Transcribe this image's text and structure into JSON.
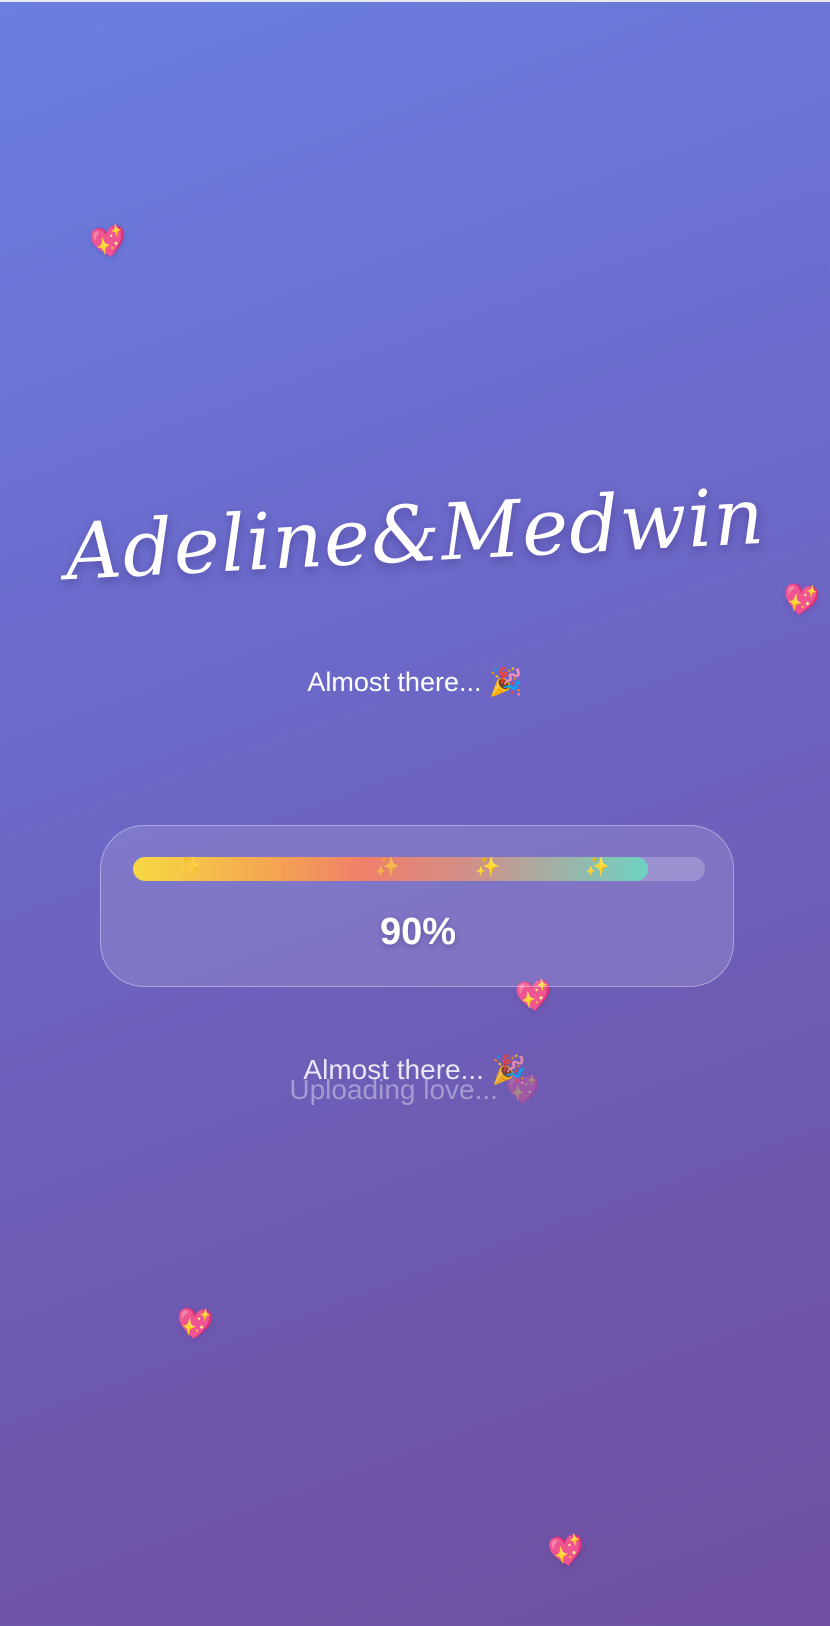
{
  "couple_title": "Adeline&Medwin",
  "subtitle": "Almost there... 🎉",
  "progress": {
    "value_percent": 90,
    "label": "90%"
  },
  "status": {
    "current": "Almost there... 🎉",
    "previous": "Uploading love... 💖"
  },
  "decorations": {
    "heart_glyph": "💖",
    "sparkle_glyph": "✨"
  },
  "colors": {
    "background_start": "#6b7fe0",
    "background_end": "#6f4f9f",
    "progress_start": "#f7d843",
    "progress_end": "#6ed3c4"
  }
}
